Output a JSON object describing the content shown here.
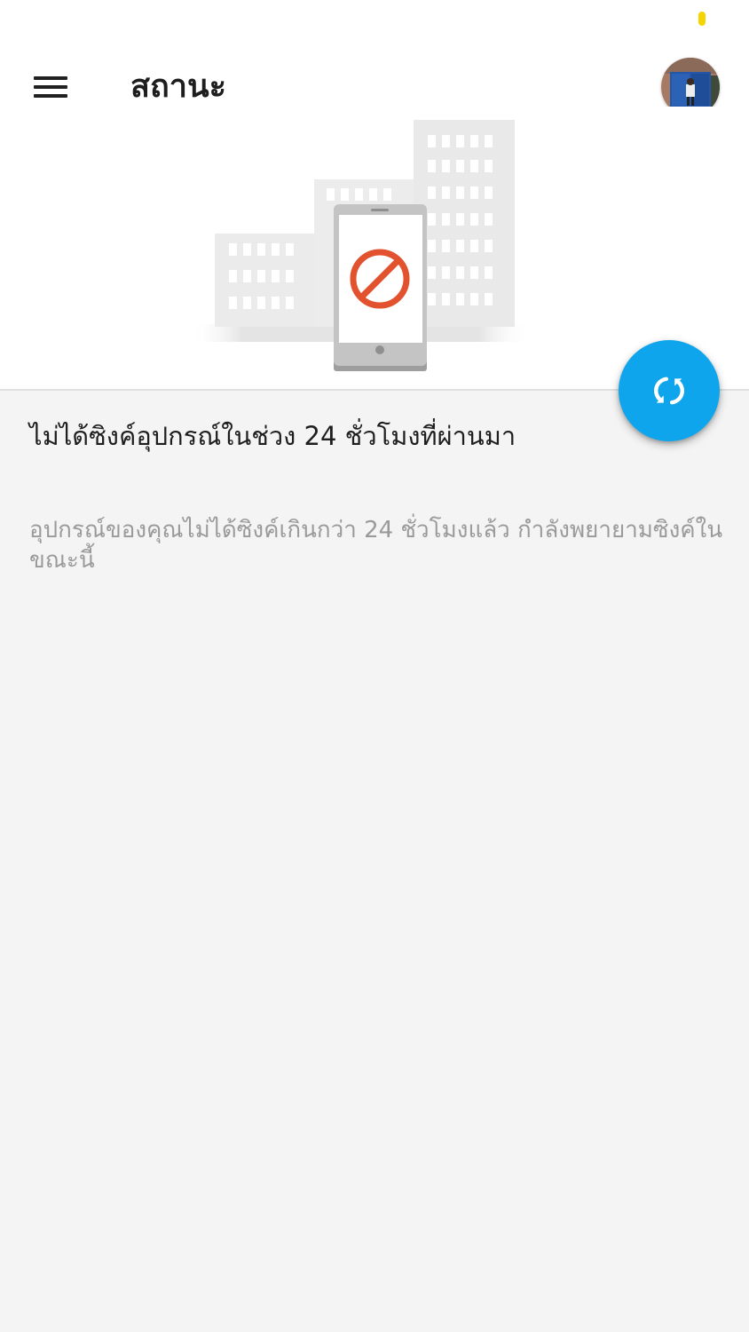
{
  "status_bar": {
    "indicator_color": "#f5d500"
  },
  "app_bar": {
    "menu_icon": "hamburger-menu-icon",
    "title": "สถานะ",
    "avatar_icon": "profile-avatar"
  },
  "illustration": {
    "icon": "phone-blocked-buildings-illustration",
    "block_color": "#e2522f"
  },
  "sync_button": {
    "icon": "sync-icon",
    "color": "#0ea5ec"
  },
  "status_message": {
    "heading": "ไม่ได้ซิงค์อุปกรณ์ในช่วง 24 ชั่วโมงที่ผ่านมา",
    "body": "อุปกรณ์ของคุณไม่ได้ซิงค์เกินกว่า 24 ชั่วโมงแล้ว กำลังพยายามซิงค์ในขณะนี้"
  }
}
